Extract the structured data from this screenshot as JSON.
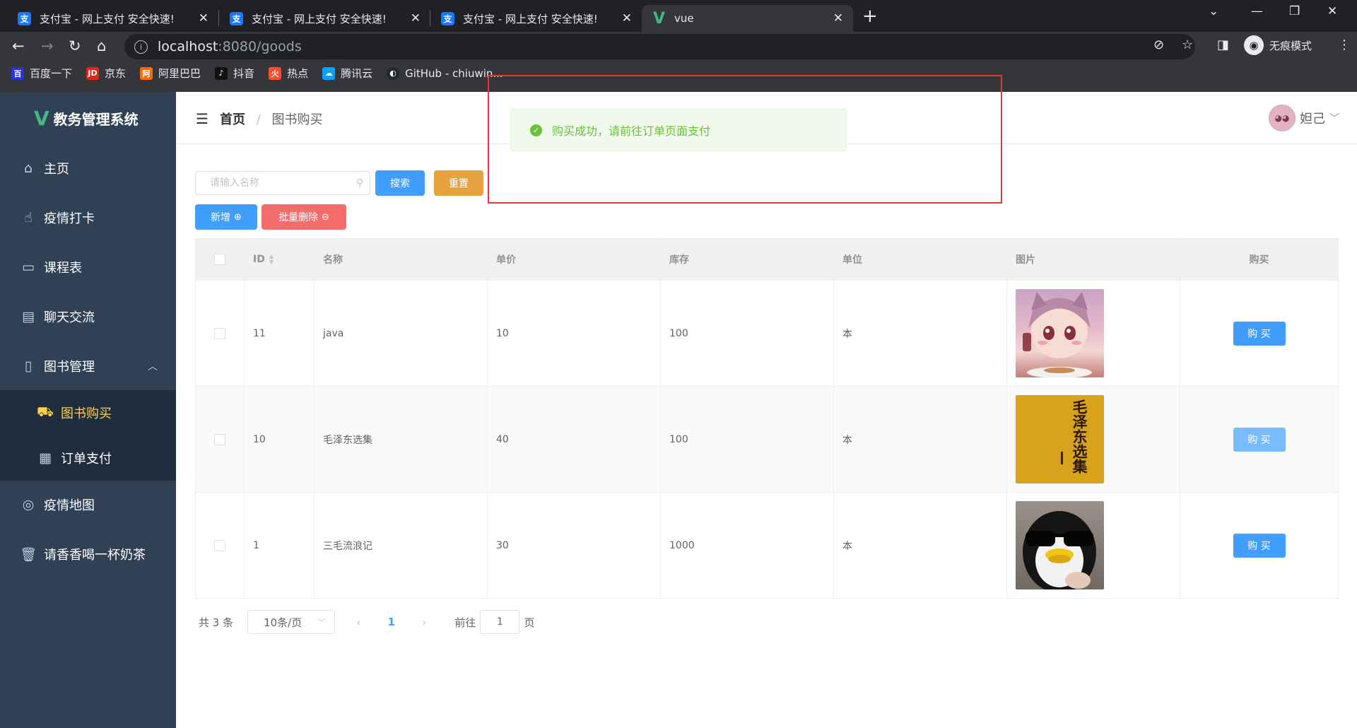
{
  "browser": {
    "tabs": [
      {
        "title": "支付宝 - 网上支付 安全快速!",
        "icon": "alipay-icon",
        "active": false
      },
      {
        "title": "支付宝 - 网上支付 安全快速!",
        "icon": "alipay-icon",
        "active": false
      },
      {
        "title": "支付宝 - 网上支付 安全快速!",
        "icon": "alipay-icon",
        "active": false
      },
      {
        "title": "vue",
        "icon": "vue-icon",
        "active": true
      }
    ],
    "url_host": "localhost",
    "url_rest": ":8080/goods",
    "incognito_label": "无痕模式",
    "bookmarks": [
      {
        "label": "百度一下",
        "icon": "baidu-icon",
        "color": "#2932e1"
      },
      {
        "label": "京东",
        "icon": "jd-icon",
        "color": "#e1251b"
      },
      {
        "label": "阿里巴巴",
        "icon": "alibaba-icon",
        "color": "#ff6a00"
      },
      {
        "label": "抖音",
        "icon": "douyin-icon",
        "color": "#111111"
      },
      {
        "label": "热点",
        "icon": "hot-icon",
        "color": "#ff4d2a"
      },
      {
        "label": "腾讯云",
        "icon": "tencent-cloud-icon",
        "color": "#00a3ff"
      },
      {
        "label": "GitHub - chiuwin...",
        "icon": "github-icon",
        "color": "#24292e"
      }
    ]
  },
  "app": {
    "title": "教务管理系统",
    "menu": [
      {
        "label": "主页",
        "icon": "home-icon"
      },
      {
        "label": "疫情打卡",
        "icon": "punch-icon"
      },
      {
        "label": "课程表",
        "icon": "monitor-icon"
      },
      {
        "label": "聊天交流",
        "icon": "chat-icon"
      },
      {
        "label": "图书管理",
        "icon": "book-icon"
      },
      {
        "label": "图书购买",
        "icon": "cart-icon"
      },
      {
        "label": "订单支付",
        "icon": "order-icon"
      },
      {
        "label": "疫情地图",
        "icon": "map-icon"
      },
      {
        "label": "请香香喝一杯奶茶",
        "icon": "cup-icon"
      }
    ],
    "breadcrumb": {
      "home": "首页",
      "separator": "/",
      "current": "图书购买"
    },
    "user": {
      "name": "妲己"
    },
    "accent": "#409eff",
    "active_menu_color": "#ffd04b"
  },
  "toolbar": {
    "search_placeholder": "请输入名称",
    "search_button": "搜索",
    "reset_button": "重置",
    "add_button": "新增",
    "batch_delete_button": "批量删除"
  },
  "table": {
    "columns": [
      "ID",
      "名称",
      "单价",
      "库存",
      "单位",
      "图片",
      "购买"
    ],
    "rows": [
      {
        "id": "11",
        "name": "java",
        "price": "10",
        "stock": "100",
        "unit": "本",
        "image": "anime-girl-image",
        "buy": "购 买"
      },
      {
        "id": "10",
        "name": "毛泽东选集",
        "price": "40",
        "stock": "100",
        "unit": "本",
        "image": "book-cover-image",
        "book_cover_text": "毛泽东选集",
        "buy": "购 买"
      },
      {
        "id": "1",
        "name": "三毛流浪记",
        "price": "30",
        "stock": "1000",
        "unit": "本",
        "image": "penguin-image",
        "buy": "购 买"
      }
    ]
  },
  "pagination": {
    "total_text": "共 3 条",
    "page_size": "10条/页",
    "current_page": "1",
    "goto_label": "前往",
    "goto_value": "1",
    "page_suffix": "页"
  },
  "toast": {
    "message": "购买成功，请前往订单页面支付",
    "type": "success",
    "color": "#67c23a"
  }
}
